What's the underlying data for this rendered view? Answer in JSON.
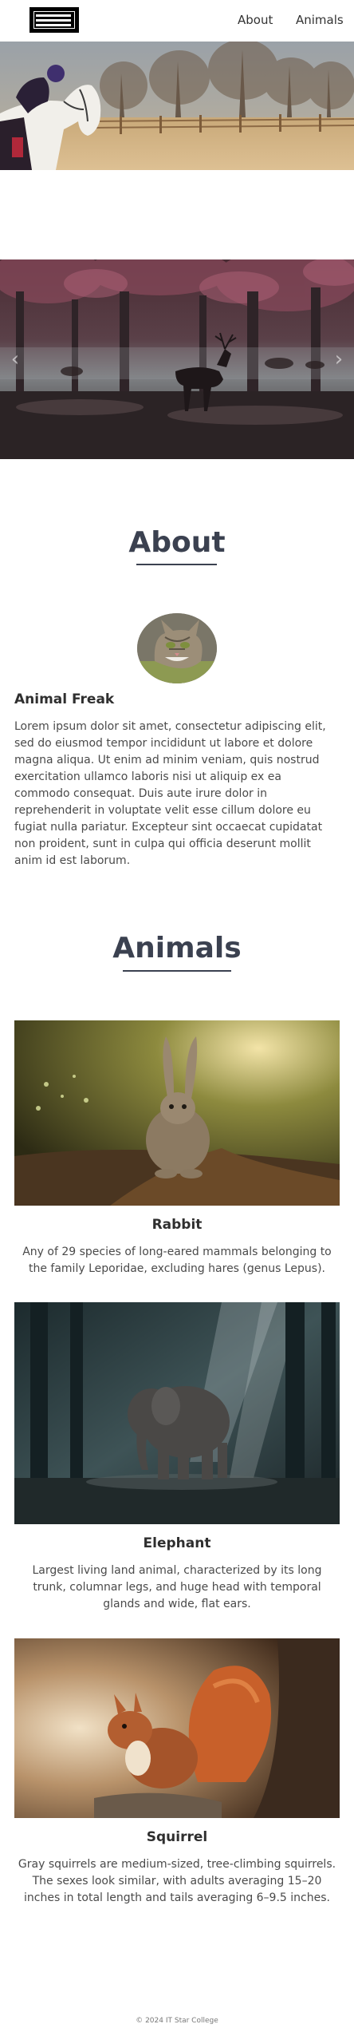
{
  "header": {
    "nav": [
      {
        "label": "About"
      },
      {
        "label": "Animals"
      }
    ]
  },
  "hero": {
    "image_icon": "horse-rider-photo"
  },
  "carousel": {
    "image_icon": "deer-forest-photo",
    "prev_glyph": "‹",
    "next_glyph": "›"
  },
  "about": {
    "title": "About",
    "avatar_icon": "cat-photo",
    "name": "Animal Freak",
    "text": "Lorem ipsum dolor sit amet, consectetur adipiscing elit, sed do eiusmod tempor incididunt ut labore et dolore magna aliqua. Ut enim ad minim veniam, quis nostrud exercitation ullamco laboris nisi ut aliquip ex ea commodo consequat. Duis aute irure dolor in reprehenderit in voluptate velit esse cillum dolore eu fugiat nulla pariatur. Excepteur sint occaecat cupidatat non proident, sunt in culpa qui officia deserunt mollit anim id est laborum."
  },
  "animals": {
    "title": "Animals",
    "items": [
      {
        "name": "Rabbit",
        "image_icon": "rabbit-photo",
        "description": "Any of 29 species of long-eared mammals belonging to the family Leporidae, excluding hares (genus Lepus)."
      },
      {
        "name": "Elephant",
        "image_icon": "elephant-photo",
        "description": "Largest living land animal, characterized by its long trunk, columnar legs, and huge head with temporal glands and wide, flat ears."
      },
      {
        "name": "Squirrel",
        "image_icon": "squirrel-photo",
        "description": "Gray squirrels are medium-sized, tree-climbing squirrels. The sexes look similar, with adults averaging 15–20 inches in total length and tails averaging 6–9.5 inches."
      }
    ]
  },
  "footer": {
    "text": "© 2024 IT Star College"
  }
}
